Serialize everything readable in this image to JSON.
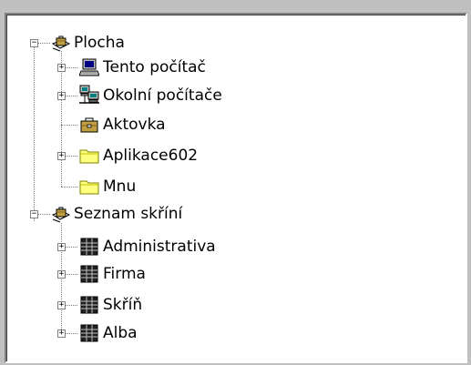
{
  "tree": {
    "nodes": [
      {
        "label": "Plocha",
        "icon": "desktop-briefcase-icon",
        "expander": "−"
      },
      {
        "label": "Tento počítač",
        "icon": "computer-icon",
        "expander": "+"
      },
      {
        "label": "Okolní počítače",
        "icon": "network-computers-icon",
        "expander": "+"
      },
      {
        "label": "Aktovka",
        "icon": "briefcase-icon",
        "expander": ""
      },
      {
        "label": "Aplikace602",
        "icon": "folder-icon",
        "expander": "+"
      },
      {
        "label": "Mnu",
        "icon": "folder-icon",
        "expander": ""
      },
      {
        "label": "Seznam skříní",
        "icon": "desktop-briefcase-icon",
        "expander": "−"
      },
      {
        "label": "Administrativa",
        "icon": "cabinet-grid-icon",
        "expander": "+"
      },
      {
        "label": "Firma",
        "icon": "cabinet-grid-icon",
        "expander": "+"
      },
      {
        "label": "Skříň",
        "icon": "cabinet-grid-icon",
        "expander": "+"
      },
      {
        "label": "Alba",
        "icon": "cabinet-grid-icon",
        "expander": "+"
      }
    ]
  }
}
